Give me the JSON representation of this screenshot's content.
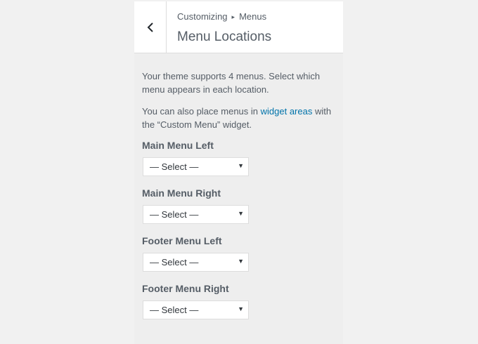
{
  "header": {
    "back_icon": "chevron-left-icon",
    "breadcrumb": {
      "parent": "Customizing",
      "separator": "▸",
      "current": "Menus"
    },
    "title": "Menu Locations"
  },
  "description": {
    "line1": "Your theme supports 4 menus. Select which menu appears in each location.",
    "line2_prefix": "You can also place menus in ",
    "line2_link": "widget areas",
    "line2_suffix": " with the “Custom Menu” widget."
  },
  "locations": [
    {
      "label": "Main Menu Left",
      "selected": "— Select —"
    },
    {
      "label": "Main Menu Right",
      "selected": "— Select —"
    },
    {
      "label": "Footer Menu Left",
      "selected": "— Select —"
    },
    {
      "label": "Footer Menu Right",
      "selected": "— Select —"
    }
  ],
  "select_arrow": "▼",
  "colors": {
    "link": "#0073aa",
    "panel_bg": "#eeeeee",
    "page_bg": "#f1f1f1",
    "text": "#555d66"
  }
}
